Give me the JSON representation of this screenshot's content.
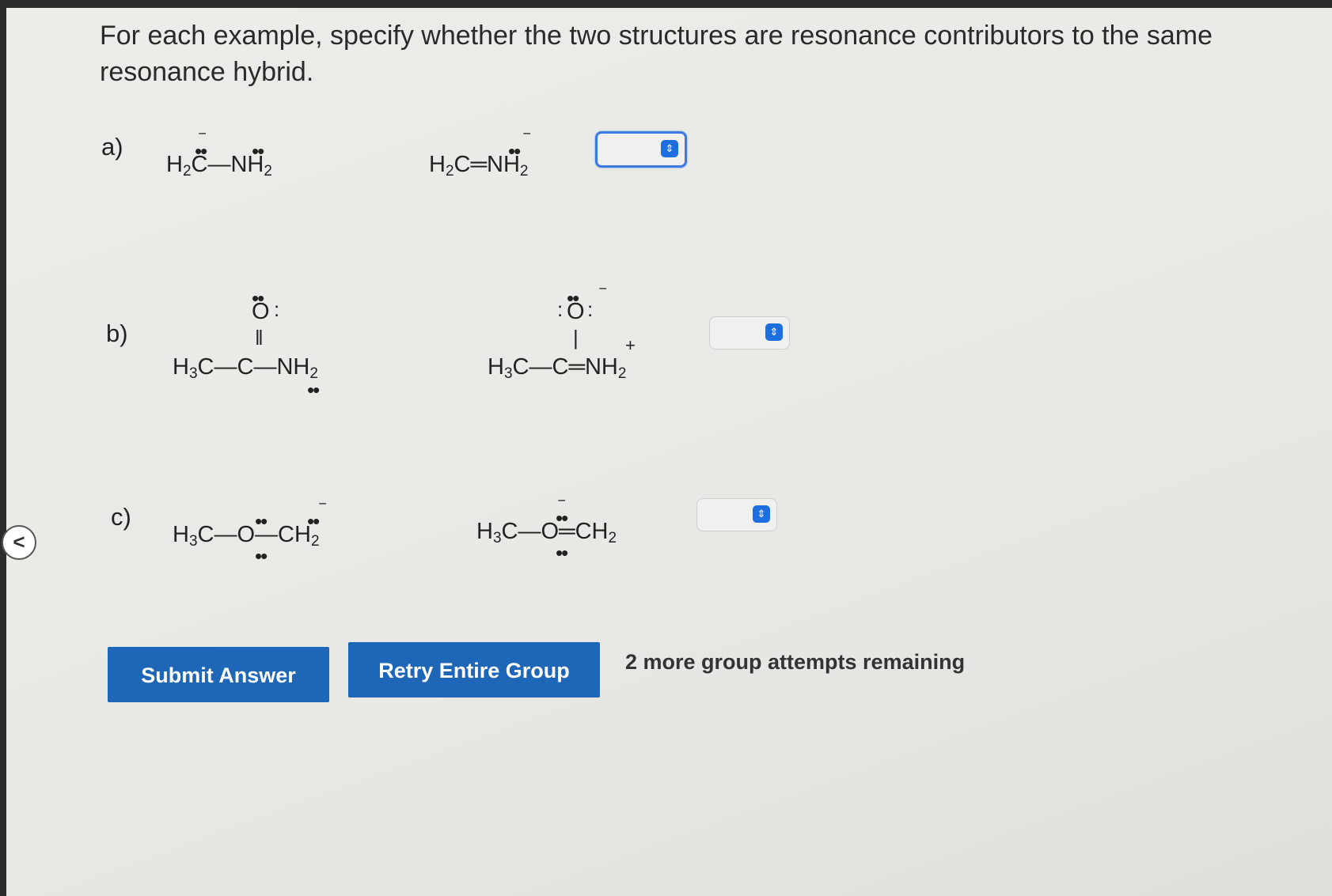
{
  "question": "For each example, specify whether the two structures are resonance contributors to the same resonance hybrid.",
  "parts": [
    {
      "label": "a)"
    },
    {
      "label": "b)"
    },
    {
      "label": "c)"
    }
  ],
  "molecules": {
    "a_left": {
      "h": "H",
      "c": "C",
      "bond": "—",
      "nh": "NH",
      "sub": "2"
    },
    "a_right": {
      "h": "H",
      "c": "C",
      "bond": "═",
      "nh": "NH",
      "sub": "2"
    },
    "b_left": {
      "h": "H",
      "sub3": "3",
      "c": "C",
      "bond": "—",
      "c2": "C",
      "nh": "NH",
      "sub2": "2",
      "o": "O"
    },
    "b_right": {
      "h": "H",
      "sub3": "3",
      "c": "C",
      "bond": "—",
      "c2": "C",
      "bond2": "═",
      "nh": "NH",
      "sub2": "2",
      "o": "O"
    },
    "c_left": {
      "h": "H",
      "sub3": "3",
      "c": "C",
      "bond": "—",
      "o": "O",
      "ch": "CH",
      "sub2": "2"
    },
    "c_right": {
      "h": "H",
      "sub3": "3",
      "c": "C",
      "bond": "—",
      "o": "O",
      "bond2": "═",
      "ch": "CH",
      "sub2": "2"
    }
  },
  "buttons": {
    "submit": "Submit Answer",
    "retry": "Retry Entire Group"
  },
  "attempts_text": "2 more group attempts remaining",
  "back_nav": "<",
  "colors": {
    "button": "#1d66b8",
    "focus": "#3b7be0"
  }
}
